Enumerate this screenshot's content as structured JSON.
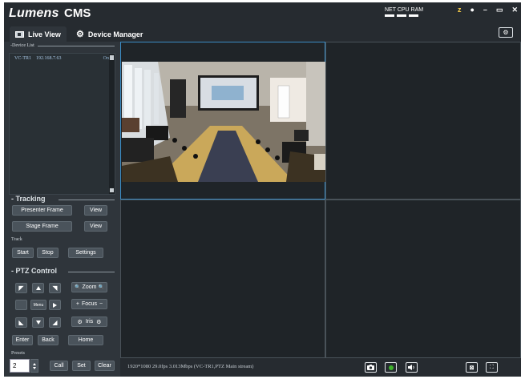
{
  "app": {
    "brand": "Lumens",
    "name": "CMS",
    "meters": {
      "label": "NET CPU RAM"
    },
    "window_icons": [
      "z",
      "info",
      "minimize",
      "maximize",
      "close"
    ],
    "window_glyphs": {
      "z": "z",
      "info": "●",
      "min": "–",
      "max": "▭",
      "close": "✕"
    }
  },
  "tabs": [
    {
      "label": "Live View",
      "icon": "live-view-icon",
      "active": true
    },
    {
      "label": "Device Manager",
      "icon": "gear-icon",
      "active": false
    }
  ],
  "sidebar": {
    "device_list_label": "-Device List",
    "devices": [
      {
        "name": "VC-TR1",
        "ip": "192.168.7.63",
        "status": "On"
      }
    ],
    "tracking": {
      "title": "- Tracking",
      "presenter_frame": "Presenter Frame",
      "stage_frame": "Stage Frame",
      "view": "View",
      "track_label": "Track",
      "start": "Start",
      "stop": "Stop",
      "settings": "Settings"
    },
    "ptz": {
      "title": "- PTZ Control",
      "menu": "Menu",
      "zoom": "Zoom",
      "zoom_glyph": "🔍",
      "focus": "Focus",
      "focus_plus": "+",
      "focus_minus": "−",
      "iris": "Iris",
      "iris_glyph": "⚙",
      "enter": "Enter",
      "back": "Back",
      "home": "Home"
    },
    "presets": {
      "label": "Presets",
      "value": "2",
      "call": "Call",
      "set": "Set",
      "clear": "Clear"
    }
  },
  "status": {
    "stream_info": "1920*1080 29.0fps 3.013Mbps (VC-TR1,PTZ Main stream)"
  },
  "colors": {
    "background": "#2f353b",
    "titlebar": "#262b30",
    "selected_border": "#3b8cc4",
    "record_green": "#3fb32c"
  }
}
